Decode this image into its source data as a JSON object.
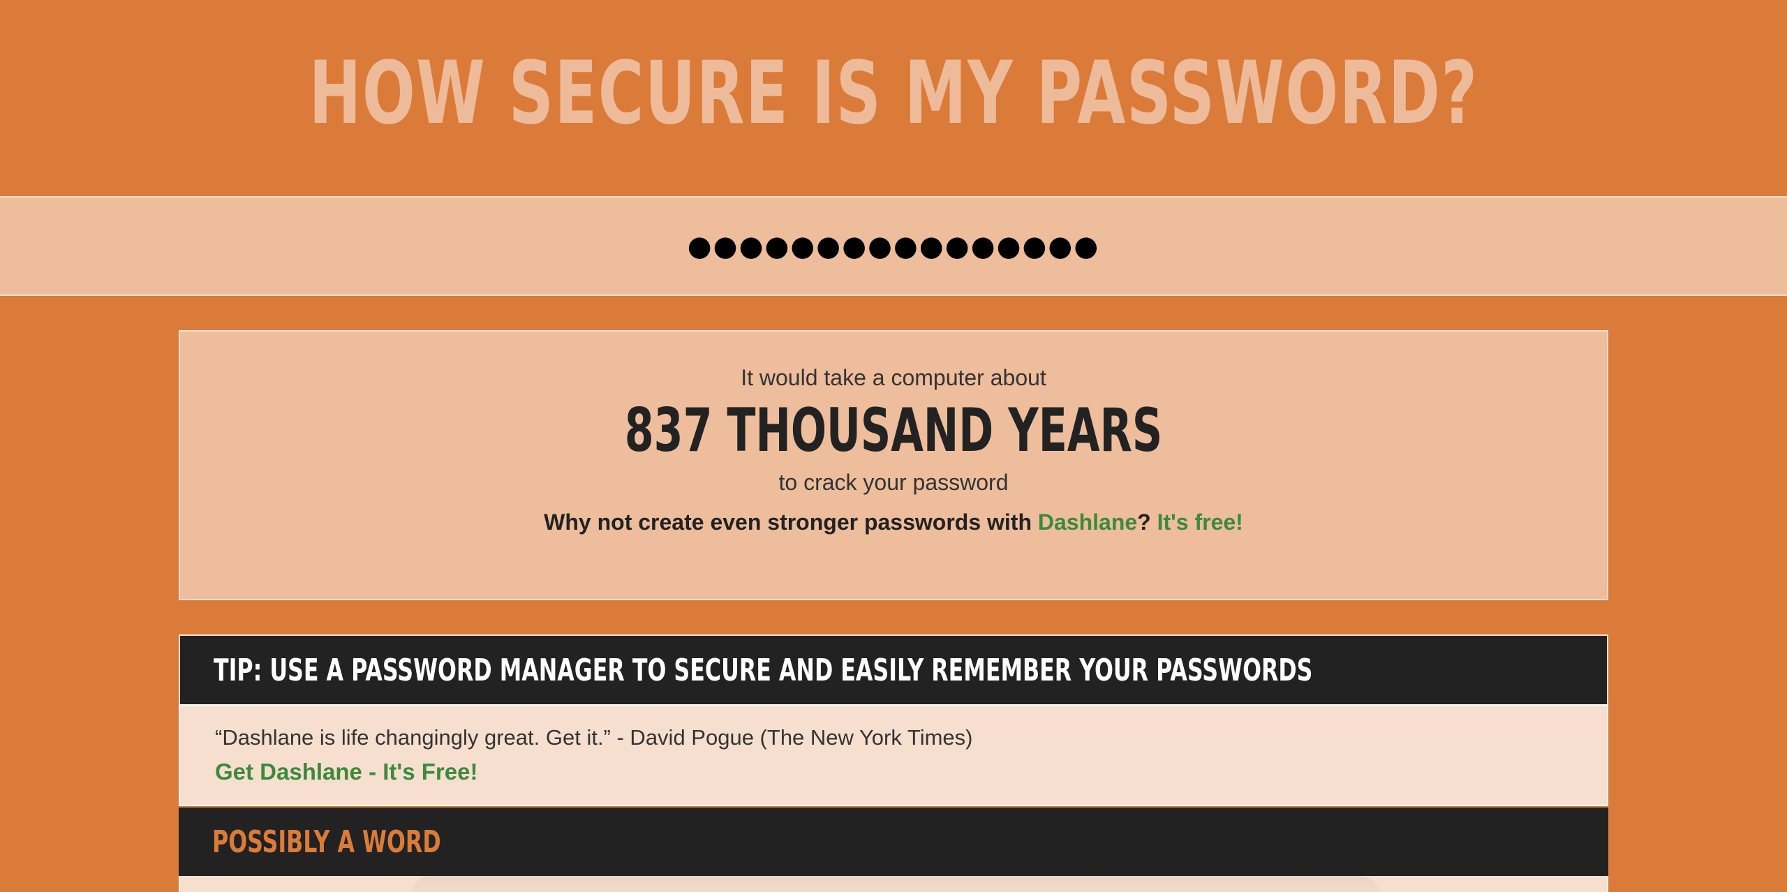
{
  "header": {
    "title": "HOW SECURE IS MY PASSWORD?"
  },
  "password_input": {
    "value": "●●●●●●●●●●●●●●●●"
  },
  "result": {
    "prefix": "It would take a computer about",
    "time": "837 THOUSAND YEARS",
    "suffix": "to crack your password",
    "cta_text": "Why not create even stronger passwords with ",
    "cta_link": "Dashlane",
    "cta_question": "?",
    "cta_free": "It's free!"
  },
  "tip": {
    "title": "TIP: USE A PASSWORD MANAGER TO SECURE AND EASILY REMEMBER YOUR PASSWORDS",
    "quote": "“Dashlane is life changingly great. Get it.” - David Pogue (The New York Times)",
    "link": "Get Dashlane - It's Free!"
  },
  "possibly_word": {
    "title": "POSSIBLY A WORD"
  },
  "colors": {
    "background": "#db7b3a",
    "light_panel": "#edbd9c",
    "pale_panel": "#f7dfcf",
    "dark_header": "#222222",
    "link_green": "#3c8a3c"
  }
}
